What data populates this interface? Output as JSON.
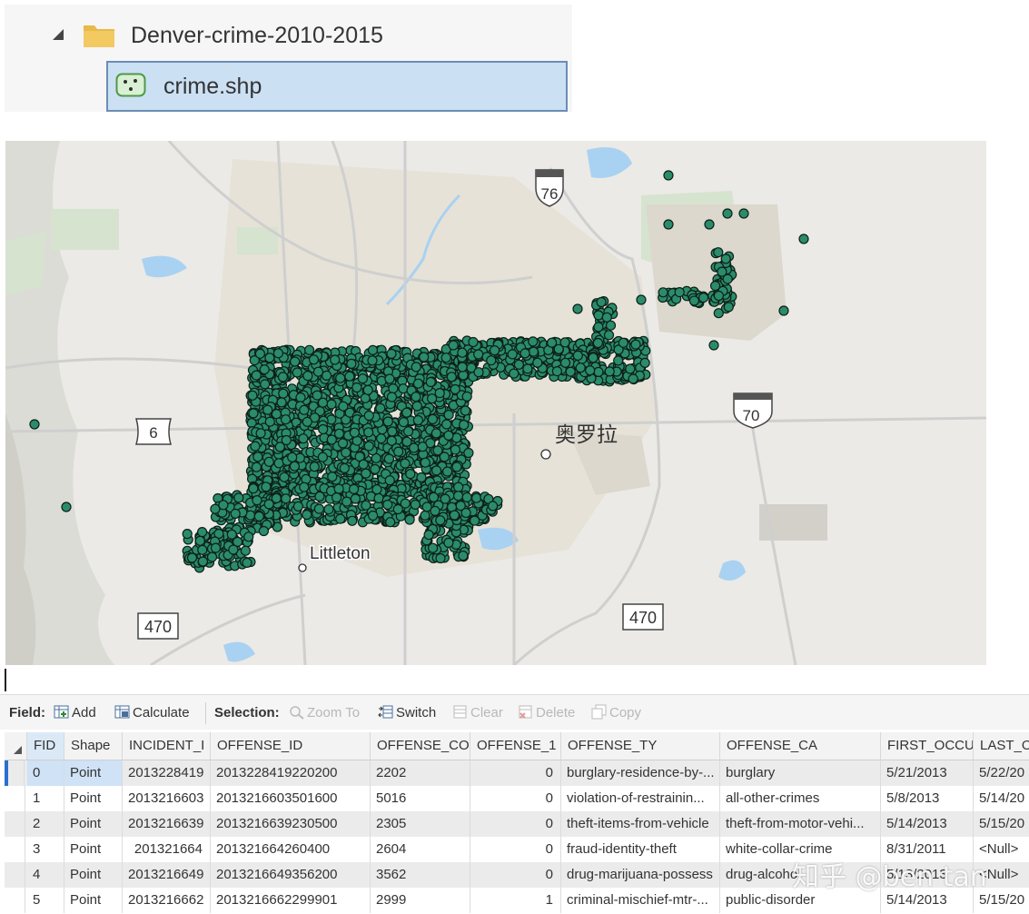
{
  "tree": {
    "folder_label": "Denver-crime-2010-2015",
    "file_label": "crime.shp"
  },
  "map": {
    "labels": {
      "route_76": "76",
      "route_6": "6",
      "route_70": "70",
      "route_470_west": "470",
      "route_470_east": "470",
      "aurora": "奥罗拉",
      "littleton": "Littleton"
    },
    "colors": {
      "point_fill": "#2a8c6b",
      "point_stroke": "#0d1f18",
      "water": "#a9d1f2",
      "road": "#cfcfcf"
    }
  },
  "toolbar": {
    "field_label": "Field:",
    "add": "Add",
    "calculate": "Calculate",
    "selection_label": "Selection:",
    "zoom_to": "Zoom To",
    "switch": "Switch",
    "clear": "Clear",
    "delete": "Delete",
    "copy": "Copy"
  },
  "table": {
    "columns": [
      "FID",
      "Shape",
      "INCIDENT_I",
      "OFFENSE_ID",
      "OFFENSE_CO",
      "OFFENSE_1",
      "OFFENSE_TY",
      "OFFENSE_CA",
      "FIRST_OCCU",
      "LAST_O"
    ],
    "rows": [
      [
        "0",
        "Point",
        "2013228419",
        "2013228419220200",
        "2202",
        "0",
        "burglary-residence-by-...",
        "burglary",
        "5/21/2013",
        "5/22/20"
      ],
      [
        "1",
        "Point",
        "2013216603",
        "2013216603501600",
        "5016",
        "0",
        "violation-of-restrainin...",
        "all-other-crimes",
        "5/8/2013",
        "5/14/20"
      ],
      [
        "2",
        "Point",
        "2013216639",
        "2013216639230500",
        "2305",
        "0",
        "theft-items-from-vehicle",
        "theft-from-motor-vehi...",
        "5/14/2013",
        "5/15/20"
      ],
      [
        "3",
        "Point",
        "201321664",
        "201321664260400",
        "2604",
        "0",
        "fraud-identity-theft",
        "white-collar-crime",
        "8/31/2011",
        "<Null>"
      ],
      [
        "4",
        "Point",
        "2013216649",
        "2013216649356200",
        "3562",
        "0",
        "drug-marijuana-possess",
        "drug-alcohol",
        "5/13/2013",
        "<Null>"
      ],
      [
        "5",
        "Point",
        "2013216662",
        "2013216662299901",
        "2999",
        "1",
        "criminal-mischief-mtr-...",
        "public-disorder",
        "5/14/2013",
        "5/15/20"
      ]
    ]
  },
  "watermark": "知乎 @ben tan"
}
